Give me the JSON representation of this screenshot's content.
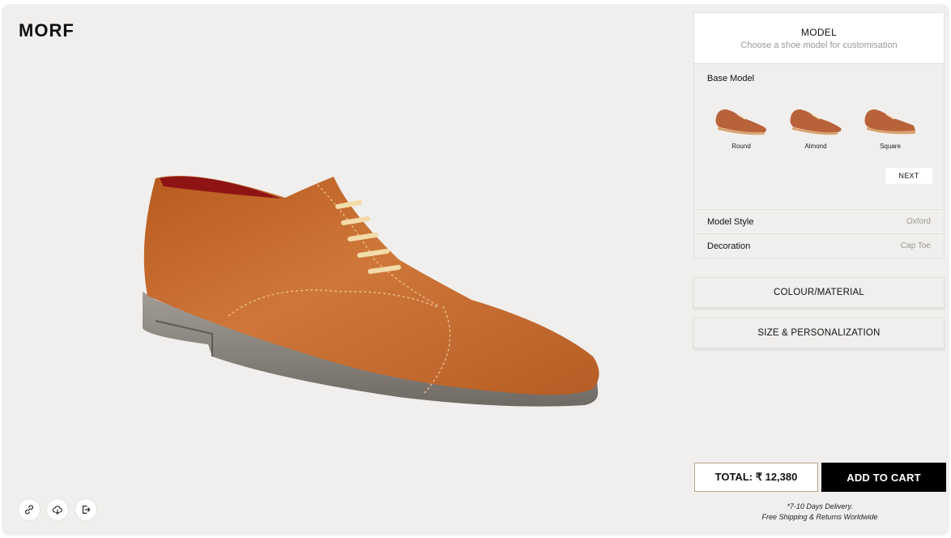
{
  "brand": {
    "logo_text": "MORF"
  },
  "toolbar": {
    "items": [
      {
        "icon": "link-icon"
      },
      {
        "icon": "cloud-save-icon"
      },
      {
        "icon": "share-exit-icon"
      }
    ]
  },
  "panel": {
    "model": {
      "title": "MODEL",
      "subtitle": "Choose a shoe model for customisation"
    },
    "base_model": {
      "label": "Base Model",
      "options": [
        {
          "label": "Round"
        },
        {
          "label": "Almond"
        },
        {
          "label": "Square"
        }
      ],
      "next_label": "NEXT"
    },
    "model_style": {
      "label": "Model Style",
      "value": "Oxford"
    },
    "decoration": {
      "label": "Decoration",
      "value": "Cap Toe"
    },
    "colour_material_label": "COLOUR/MATERIAL",
    "size_personalization_label": "SIZE & PERSONALIZATION"
  },
  "checkout": {
    "total_label": "TOTAL: ₹ 12,380",
    "add_to_cart_label": "ADD TO CART",
    "delivery_line1": "*7-10 Days Delivery.",
    "delivery_line2": "Free Shipping & Returns Worldwide"
  },
  "colors": {
    "background": "#f1efed",
    "leather": "#c46a2e",
    "lining": "#8e1414",
    "sole": "#8b8680",
    "laces": "#f3dcaa",
    "cart_button": "#000000",
    "total_border": "#b8a98a"
  }
}
